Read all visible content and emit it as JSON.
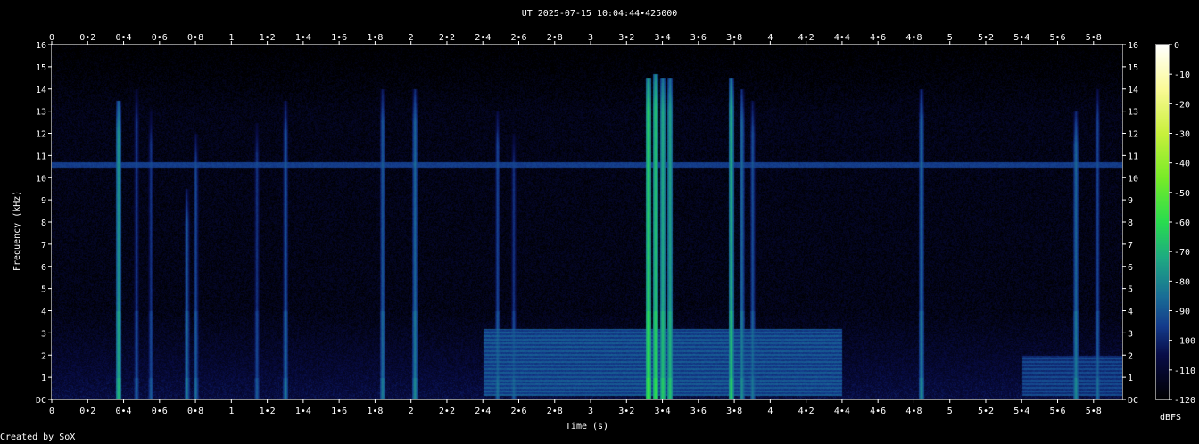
{
  "chart_data": {
    "type": "heatmap",
    "title": "UT 2025-07-15 10:04:44•425000",
    "xlabel": "Time (s)",
    "ylabel": "Frequency (kHz)",
    "xlim": [
      0,
      5.96
    ],
    "ylim": [
      0,
      16
    ],
    "x_ticks": [
      "0",
      "0•2",
      "0•4",
      "0•6",
      "0•8",
      "1",
      "1•2",
      "1•4",
      "1•6",
      "1•8",
      "2",
      "2•2",
      "2•4",
      "2•6",
      "2•8",
      "3",
      "3•2",
      "3•4",
      "3•6",
      "3•8",
      "4",
      "4•2",
      "4•4",
      "4•6",
      "4•8",
      "5",
      "5•2",
      "5•4",
      "5•6",
      "5•8"
    ],
    "y_ticks": [
      "DC",
      "1",
      "2",
      "3",
      "4",
      "5",
      "6",
      "7",
      "8",
      "9",
      "10",
      "11",
      "12",
      "13",
      "14",
      "15",
      "16"
    ],
    "colorbar": {
      "label": "dBFS",
      "ticks": [
        "0",
        "-10",
        "-20",
        "-30",
        "-40",
        "-50",
        "-60",
        "-70",
        "-80",
        "-90",
        "-100",
        "-110",
        "-120"
      ],
      "range": [
        -120,
        0
      ]
    },
    "features": {
      "tone_hz": 10600,
      "tone_level_dbfs": -95,
      "noise_floor_dbfs": -115,
      "impulses": [
        {
          "t": 0.37,
          "top_khz": 13.5,
          "level_dbfs": -75
        },
        {
          "t": 0.47,
          "top_khz": 14.0,
          "level_dbfs": -95
        },
        {
          "t": 0.55,
          "top_khz": 13.0,
          "level_dbfs": -95
        },
        {
          "t": 0.75,
          "top_khz": 9.5,
          "level_dbfs": -90
        },
        {
          "t": 0.8,
          "top_khz": 12.0,
          "level_dbfs": -92
        },
        {
          "t": 1.14,
          "top_khz": 12.5,
          "level_dbfs": -95
        },
        {
          "t": 1.3,
          "top_khz": 13.5,
          "level_dbfs": -90
        },
        {
          "t": 1.84,
          "top_khz": 14.0,
          "level_dbfs": -88
        },
        {
          "t": 2.02,
          "top_khz": 14.0,
          "level_dbfs": -85
        },
        {
          "t": 2.48,
          "top_khz": 13.0,
          "level_dbfs": -92
        },
        {
          "t": 2.57,
          "top_khz": 12.0,
          "level_dbfs": -95
        },
        {
          "t": 3.32,
          "top_khz": 14.5,
          "level_dbfs": -62
        },
        {
          "t": 3.36,
          "top_khz": 14.7,
          "level_dbfs": -65
        },
        {
          "t": 3.4,
          "top_khz": 14.5,
          "level_dbfs": -70
        },
        {
          "t": 3.44,
          "top_khz": 14.5,
          "level_dbfs": -72
        },
        {
          "t": 3.78,
          "top_khz": 14.5,
          "level_dbfs": -72
        },
        {
          "t": 3.84,
          "top_khz": 14.0,
          "level_dbfs": -85
        },
        {
          "t": 3.9,
          "top_khz": 13.5,
          "level_dbfs": -90
        },
        {
          "t": 4.84,
          "top_khz": 14.0,
          "level_dbfs": -85
        },
        {
          "t": 5.7,
          "top_khz": 13.0,
          "level_dbfs": -85
        },
        {
          "t": 5.82,
          "top_khz": 14.0,
          "level_dbfs": -92
        }
      ],
      "bands": [
        {
          "t0": 2.4,
          "t1": 4.4,
          "f0_khz": 0.2,
          "f1_khz": 3.2,
          "level_dbfs": -92
        },
        {
          "t0": 5.4,
          "t1": 5.96,
          "f0_khz": 0.2,
          "f1_khz": 2.0,
          "level_dbfs": -95
        }
      ]
    }
  },
  "footer": {
    "credit": "Created by SoX"
  }
}
